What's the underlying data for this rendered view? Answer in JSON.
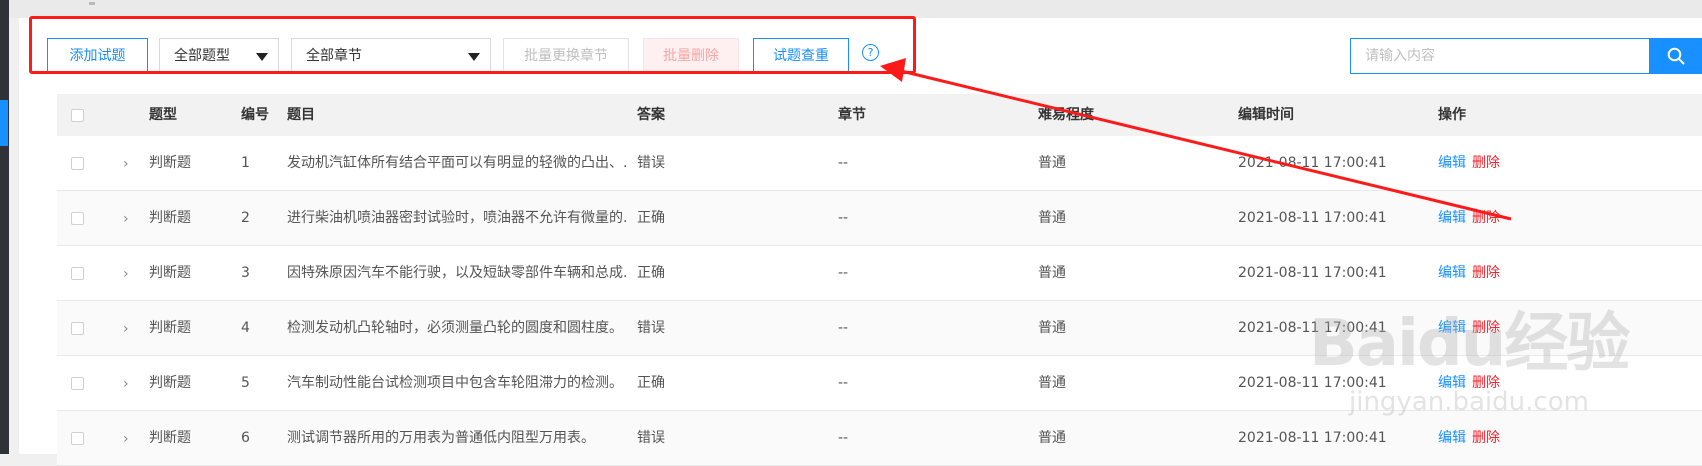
{
  "toolbar": {
    "add_label": "添加试题",
    "type_select": "全部题型",
    "chapter_select": "全部章节",
    "batch_chapter_label": "批量更换章节",
    "batch_delete_label": "批量删除",
    "dedupe_label": "试题查重",
    "help_glyph": "?"
  },
  "search": {
    "placeholder": "请输入内容",
    "icon": "search-icon"
  },
  "table": {
    "headers": {
      "type": "题型",
      "number": "编号",
      "question": "题目",
      "answer": "答案",
      "chapter": "章节",
      "difficulty": "难易程度",
      "edited": "编辑时间",
      "ops": "操作"
    },
    "rows": [
      {
        "type": "判断题",
        "number": "1",
        "question": "发动机汽缸体所有结合平面可以有明显的轻微的凸出、...",
        "answer": "错误",
        "chapter": "--",
        "difficulty": "普通",
        "edited": "2021-08-11 17:00:41",
        "edit": "编辑",
        "del": "删除"
      },
      {
        "type": "判断题",
        "number": "2",
        "question": "进行柴油机喷油器密封试验时，喷油器不允许有微量的...",
        "answer": "正确",
        "chapter": "--",
        "difficulty": "普通",
        "edited": "2021-08-11 17:00:41",
        "edit": "编辑",
        "del": "删除"
      },
      {
        "type": "判断题",
        "number": "3",
        "question": "因特殊原因汽车不能行驶，以及短缺零部件车辆和总成...",
        "answer": "正确",
        "chapter": "--",
        "difficulty": "普通",
        "edited": "2021-08-11 17:00:41",
        "edit": "编辑",
        "del": "删除"
      },
      {
        "type": "判断题",
        "number": "4",
        "question": "检测发动机凸轮轴时，必须测量凸轮的圆度和圆柱度。",
        "answer": "错误",
        "chapter": "--",
        "difficulty": "普通",
        "edited": "2021-08-11 17:00:41",
        "edit": "编辑",
        "del": "删除"
      },
      {
        "type": "判断题",
        "number": "5",
        "question": "汽车制动性能台试检测项目中包含车轮阻滞力的检测。",
        "answer": "正确",
        "chapter": "--",
        "difficulty": "普通",
        "edited": "2021-08-11 17:00:41",
        "edit": "编辑",
        "del": "删除"
      },
      {
        "type": "判断题",
        "number": "6",
        "question": "测试调节器所用的万用表为普通低内阻型万用表。",
        "answer": "错误",
        "chapter": "--",
        "difficulty": "普通",
        "edited": "2021-08-11 17:00:41",
        "edit": "编辑",
        "del": "删除"
      }
    ]
  },
  "watermark": {
    "main": "Baidu经验",
    "sub": "jingyan.baidu.com"
  },
  "colors": {
    "accent": "#1890ff",
    "danger": "#f5222d",
    "annotation": "#ff1a1a"
  }
}
